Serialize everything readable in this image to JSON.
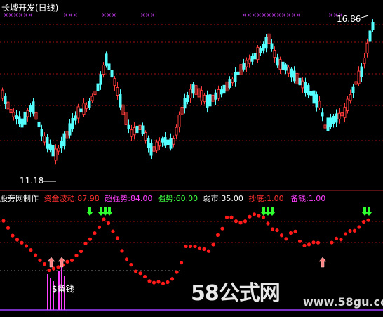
{
  "window_title": "长城开发(日线)",
  "price_high_label": "16.86",
  "price_low_label": "11.18",
  "indicator_header": {
    "source": "股旁网制作",
    "items": [
      {
        "label": "资金波动:",
        "value": "87.98",
        "color": "#ff3030"
      },
      {
        "label": "超强势:",
        "value": "84.00",
        "color": "#ff40ff"
      },
      {
        "label": "强势:",
        "value": "60.00",
        "color": "#40ff40"
      },
      {
        "label": "弱市:",
        "value": "35.00",
        "color": "#ffffff"
      },
      {
        "label": "抄底:",
        "value": "1.00",
        "color": "#ff3030"
      },
      {
        "label": "备钱:",
        "value": "1.00",
        "color": "#ff40ff"
      }
    ]
  },
  "signal_text": "$备钱",
  "watermark": {
    "brand": "58公式网",
    "url": "www.58gu.com"
  },
  "colors": {
    "up_candle": "#ff3b3b",
    "down_candle": "#54ffff",
    "marker": "#d040ff",
    "grid": "#a01010",
    "dot": "#ff1a1a"
  }
}
